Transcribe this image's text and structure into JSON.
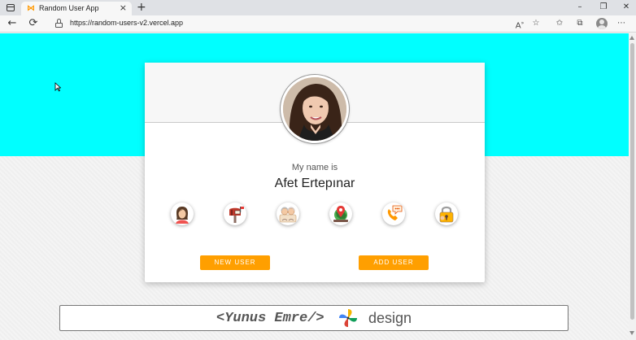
{
  "browser": {
    "tab_title": "Random User App",
    "tab_close": "×",
    "new_tab": "+",
    "url": "https://random-users-v2.vercel.app",
    "window_controls": {
      "minimize": "–",
      "maximize": "❐",
      "close": "✕"
    },
    "nav": {
      "back": "←",
      "refresh": "⟳"
    },
    "toolbar_icons": [
      "read-aloud-icon",
      "favorite-star-icon",
      "favorites-icon",
      "collections-icon",
      "profile-icon",
      "more-icon"
    ]
  },
  "page": {
    "background_color": "#00ffff",
    "card": {
      "greeting": "My name is",
      "name": "Afet Ertepınar",
      "info_icons": [
        "user-icon",
        "email-icon",
        "age-icon",
        "location-icon",
        "phone-icon",
        "password-icon"
      ],
      "new_user_label": "NEW USER",
      "add_user_label": "ADD USER",
      "accent_color": "#ff9f00"
    },
    "footer": {
      "code_text": "<Yunus Emre/>",
      "design_text": "design"
    }
  }
}
